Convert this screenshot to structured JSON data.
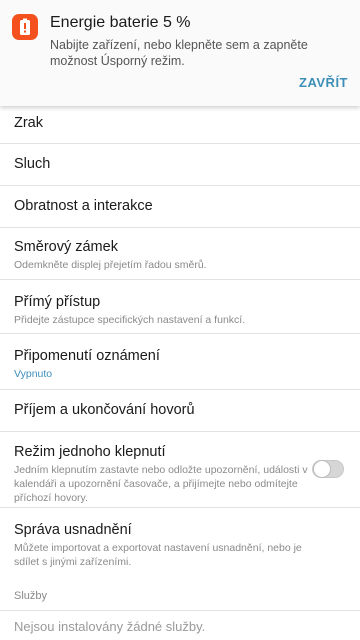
{
  "notification": {
    "icon": "battery-alert-icon",
    "accent_color": "#f4511e",
    "title": "Energie baterie 5 %",
    "text": "Nabijte zařízení, nebo klepněte sem a zapněte možnost Úsporný režim.",
    "action_label": "ZAVŘÍT"
  },
  "settings": {
    "items": [
      {
        "title": "Zrak"
      },
      {
        "title": "Sluch"
      },
      {
        "title": "Obratnost a interakce"
      },
      {
        "title": "Směrový zámek",
        "subtitle": "Odemkněte displej přejetím řadou směrů."
      },
      {
        "title": "Přímý přístup",
        "subtitle": "Přidejte zástupce specifických nastavení a funkcí."
      },
      {
        "title": "Připomenutí oznámení",
        "subtitle": "Vypnuto"
      },
      {
        "title": "Příjem a ukončování hovorů"
      },
      {
        "title": "Režim jednoho klepnutí",
        "subtitle": "Jedním klepnutím zastavte nebo odložte upozornění, události v kalendáři a upozornění časovače, a přijímejte nebo odmítejte příchozí hovory.",
        "toggle": false
      },
      {
        "title": "Správa usnadnění",
        "subtitle": "Můžete importovat a exportovat nastavení usnadnění, nebo je sdílet s jinými zařízeními."
      }
    ],
    "services_header": "Služby",
    "services_empty": "Nejsou instalovány žádné služby."
  },
  "colors": {
    "link": "#3d8fb8",
    "toggle_off": "#d6d6d6"
  }
}
